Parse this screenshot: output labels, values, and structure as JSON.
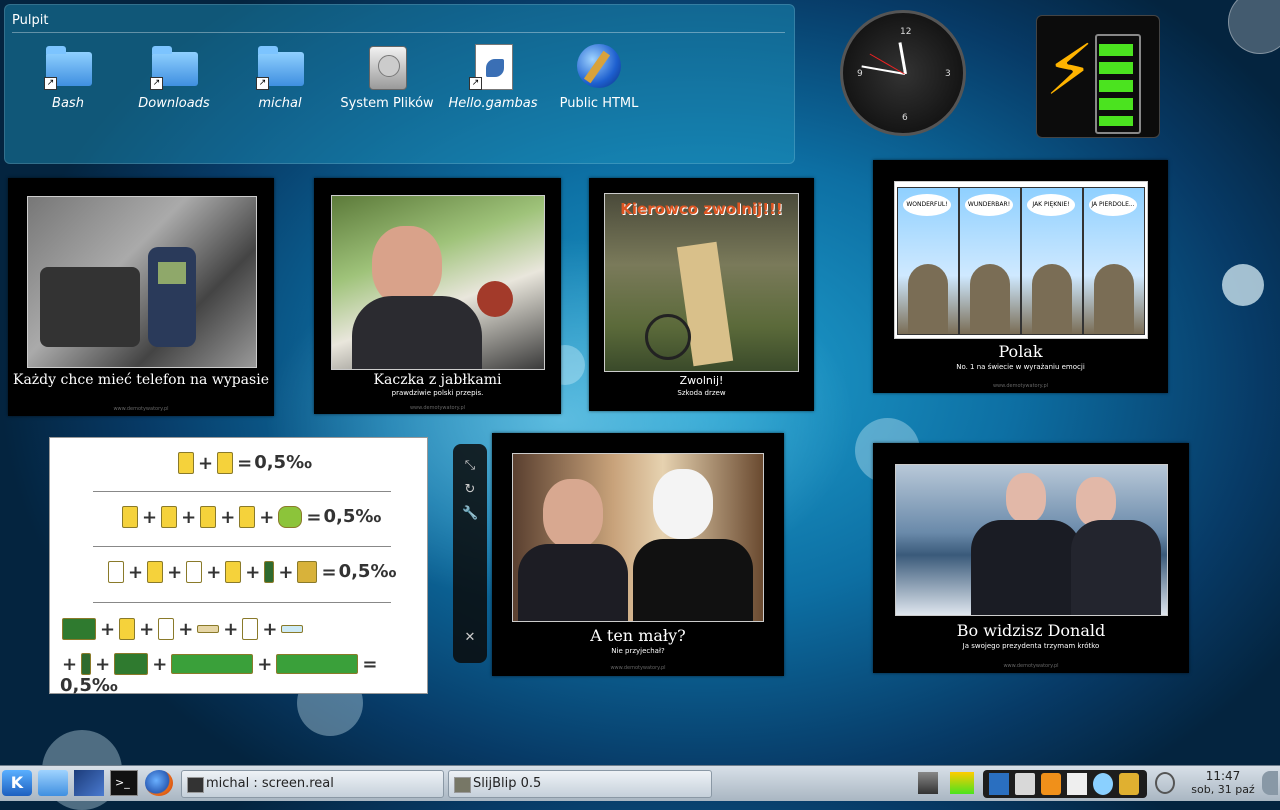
{
  "folderview": {
    "title": "Pulpit",
    "items": [
      {
        "label": "Bash",
        "icon": "folder-link-icon",
        "italic": true
      },
      {
        "label": "Downloads",
        "icon": "folder-link-icon",
        "italic": true
      },
      {
        "label": "michal",
        "icon": "folder-link-icon",
        "italic": true
      },
      {
        "label": "System Plików",
        "icon": "hard-drive-icon",
        "italic": false
      },
      {
        "label": "Hello.gambas",
        "icon": "gambas-file-icon",
        "italic": true
      },
      {
        "label": "Public HTML",
        "icon": "globe-icon",
        "italic": false
      }
    ]
  },
  "clock_widget": {
    "numerals": [
      "12",
      "3",
      "6",
      "9"
    ],
    "time": "11:47"
  },
  "frames": [
    {
      "caption": "Każdy chce mieć telefon na wypasie",
      "subtitle": "",
      "watermark": "www.demotywatory.pl"
    },
    {
      "caption": "Kaczka z jabłkami",
      "subtitle": "prawdziwie polski przepis.",
      "watermark": "www.demotywatory.pl"
    },
    {
      "caption": "Zwolnij!",
      "subtitle": "Szkoda drzew",
      "watermark": "",
      "photo_text": "Kierowco zwolnij!!!"
    },
    {
      "caption": "Polak",
      "subtitle": "No. 1 na świecie w wyrażaniu emocji",
      "watermark": "www.demotywatory.pl",
      "bubbles": [
        "WONDERFUL!",
        "WUNDERBAR!",
        "JAK PIĘKNIE!",
        "JA PIERDOLE..."
      ]
    },
    {
      "caption": "A ten mały?",
      "subtitle": "Nie przyjechał?",
      "watermark": "www.demotywatory.pl"
    },
    {
      "caption": "Bo widzisz Donald",
      "subtitle": "Ja swojego prezydenta trzymam krótko",
      "watermark": "www.demotywatory.pl"
    }
  ],
  "equation_card": {
    "result": "0,5‰"
  },
  "applet_handle": {
    "icons": [
      "resize-icon",
      "rotate-icon",
      "settings-wrench-icon",
      "close-icon"
    ]
  },
  "panel": {
    "tasks": [
      {
        "label": "michal : screen.real",
        "icon": "terminal-icon"
      },
      {
        "label": "SlijBlip 0.5",
        "icon": "application-icon"
      }
    ],
    "clock": {
      "time": "11:47",
      "date": "sob, 31 paź"
    },
    "launchers": [
      "kde-menu-icon",
      "dolphin-icon",
      "desktop-icon",
      "konsole-icon",
      "firefox-icon"
    ]
  },
  "colors": {
    "accent": "#1fa0cf",
    "panel": "#c5d0da",
    "battery_green": "#4be31f"
  }
}
